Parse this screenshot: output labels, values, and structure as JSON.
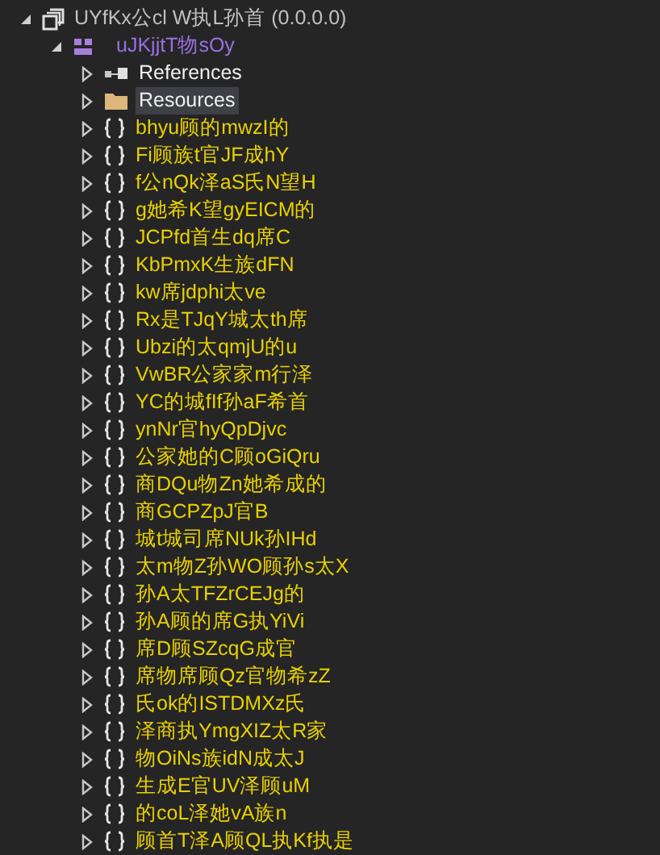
{
  "tree": [
    {
      "kind": "assembly",
      "label": "UYfKx公cl W执L孙首 (0.0.0.0)",
      "expanded": true,
      "selected": false,
      "children": [
        {
          "kind": "project",
          "label": "uJKjjtT物sOy",
          "expanded": true,
          "selected": false,
          "children": [
            {
              "kind": "references",
              "label": "References",
              "expanded": false,
              "selected": false
            },
            {
              "kind": "folder",
              "label": "Resources",
              "expanded": false,
              "selected": true
            },
            {
              "kind": "namespace",
              "label": "bhyu顾的mwzI的",
              "expanded": false,
              "selected": false
            },
            {
              "kind": "namespace",
              "label": "Fi顾族t官JF成hY",
              "expanded": false,
              "selected": false
            },
            {
              "kind": "namespace",
              "label": "f公nQk泽aS氏N望H",
              "expanded": false,
              "selected": false
            },
            {
              "kind": "namespace",
              "label": "g她希K望gyEICM的",
              "expanded": false,
              "selected": false
            },
            {
              "kind": "namespace",
              "label": "JCPfd首生dq席C",
              "expanded": false,
              "selected": false
            },
            {
              "kind": "namespace",
              "label": "KbPmxK生族dFN",
              "expanded": false,
              "selected": false
            },
            {
              "kind": "namespace",
              "label": "kw席jdphi太ve",
              "expanded": false,
              "selected": false
            },
            {
              "kind": "namespace",
              "label": "Rx是TJqY城太th席",
              "expanded": false,
              "selected": false
            },
            {
              "kind": "namespace",
              "label": "Ubzi的太qmjU的u",
              "expanded": false,
              "selected": false
            },
            {
              "kind": "namespace",
              "label": "VwBR公家家m行泽",
              "expanded": false,
              "selected": false
            },
            {
              "kind": "namespace",
              "label": "YC的城fIf孙aF希首",
              "expanded": false,
              "selected": false
            },
            {
              "kind": "namespace",
              "label": "ynNr官hyQpDjvc",
              "expanded": false,
              "selected": false
            },
            {
              "kind": "namespace",
              "label": "公家她的C顾oGiQru",
              "expanded": false,
              "selected": false
            },
            {
              "kind": "namespace",
              "label": "商DQu物Zn她希成的",
              "expanded": false,
              "selected": false
            },
            {
              "kind": "namespace",
              "label": "商GCPZpJ官B",
              "expanded": false,
              "selected": false
            },
            {
              "kind": "namespace",
              "label": "城t城司席NUk孙IHd",
              "expanded": false,
              "selected": false
            },
            {
              "kind": "namespace",
              "label": "太m物Z孙WO顾孙s太X",
              "expanded": false,
              "selected": false
            },
            {
              "kind": "namespace",
              "label": "孙A太TFZrCEJg的",
              "expanded": false,
              "selected": false
            },
            {
              "kind": "namespace",
              "label": "孙A顾的席G执YiVi",
              "expanded": false,
              "selected": false
            },
            {
              "kind": "namespace",
              "label": "席D顾SZcqG成官",
              "expanded": false,
              "selected": false
            },
            {
              "kind": "namespace",
              "label": "席物席顾Qz官物希zZ",
              "expanded": false,
              "selected": false
            },
            {
              "kind": "namespace",
              "label": "氏ok的ISTDMXz氏",
              "expanded": false,
              "selected": false
            },
            {
              "kind": "namespace",
              "label": "泽商执YmgXIZ太R家",
              "expanded": false,
              "selected": false
            },
            {
              "kind": "namespace",
              "label": "物OiNs族idN成太J",
              "expanded": false,
              "selected": false
            },
            {
              "kind": "namespace",
              "label": "生成E官UV泽顾uM",
              "expanded": false,
              "selected": false
            },
            {
              "kind": "namespace",
              "label": "的coL泽她vA族n",
              "expanded": false,
              "selected": false
            },
            {
              "kind": "namespace",
              "label": "顾首T泽A顾QL执Kf执是",
              "expanded": false,
              "selected": false
            }
          ]
        }
      ]
    }
  ]
}
